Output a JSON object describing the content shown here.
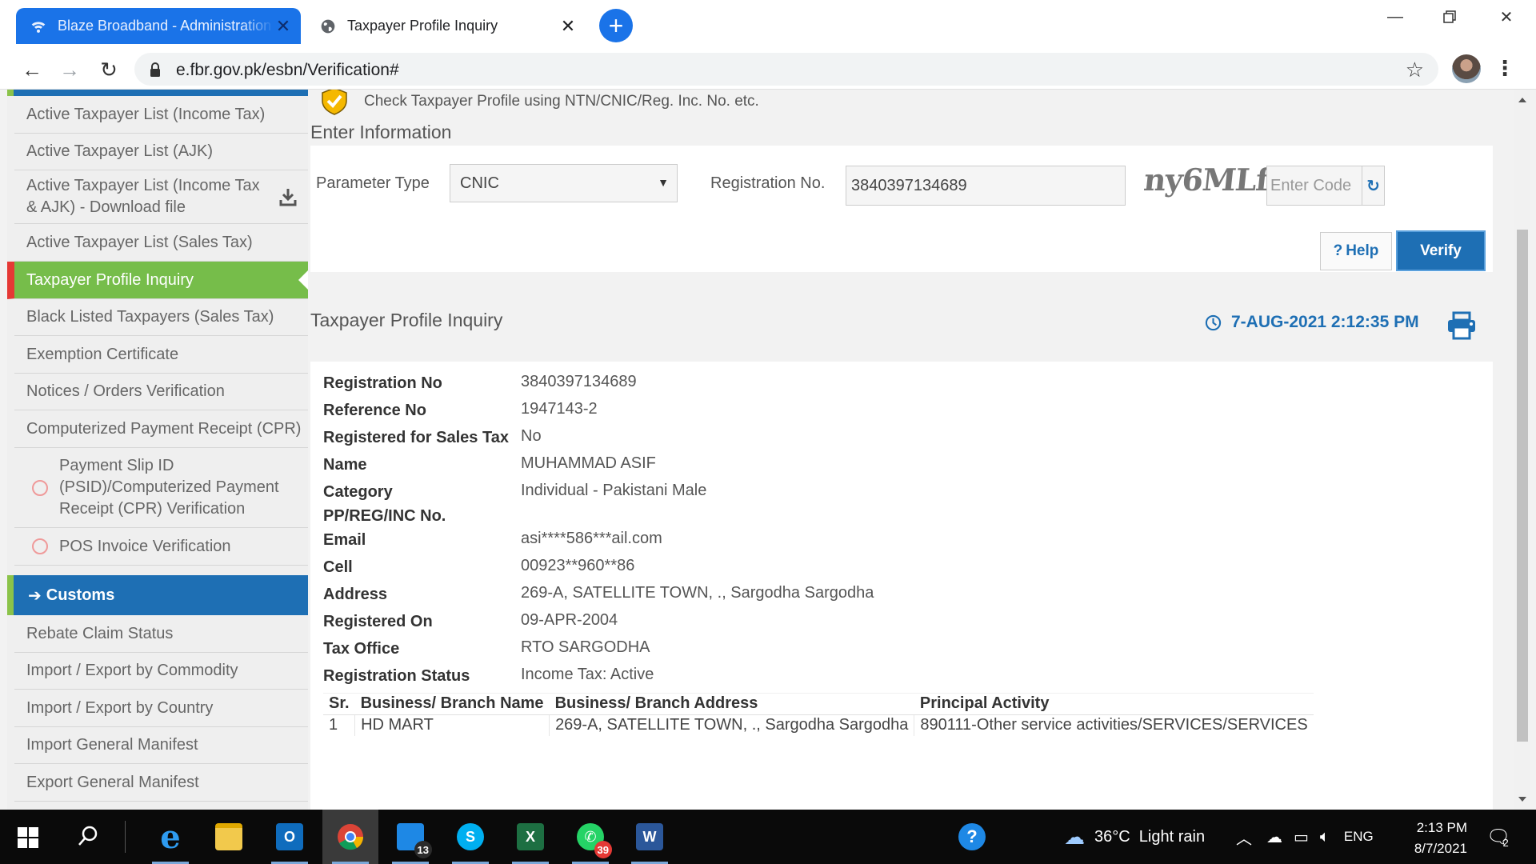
{
  "browser": {
    "tabs": [
      {
        "title": "Blaze Broadband - Administration",
        "active": false
      },
      {
        "title": "Taxpayer Profile Inquiry",
        "active": true
      }
    ],
    "url": "e.fbr.gov.pk/esbn/Verification#"
  },
  "sidebar": {
    "items": [
      {
        "label": "Active Taxpayer List (Income Tax)"
      },
      {
        "label": "Active Taxpayer List (AJK)"
      },
      {
        "label": "Active Taxpayer List (Income Tax & AJK) - Download file"
      },
      {
        "label": "Active Taxpayer List (Sales Tax)"
      },
      {
        "label": "Taxpayer Profile Inquiry"
      },
      {
        "label": "Black Listed Taxpayers (Sales Tax)"
      },
      {
        "label": "Exemption Certificate"
      },
      {
        "label": "Notices / Orders Verification"
      },
      {
        "label": "Computerized Payment Receipt (CPR)"
      },
      {
        "label": "Payment Slip ID (PSID)/Computerized Payment Receipt (CPR) Verification"
      },
      {
        "label": "POS Invoice Verification"
      }
    ],
    "customs_header": "Customs",
    "customs_items": [
      {
        "label": "Rebate Claim Status"
      },
      {
        "label": "Import / Export by Commodity"
      },
      {
        "label": "Import / Export by Country"
      },
      {
        "label": "Import General Manifest"
      },
      {
        "label": "Export General Manifest"
      }
    ]
  },
  "form": {
    "check_text": "Check Taxpayer Profile using NTN/CNIC/Reg. Inc. No. etc.",
    "enter_info": "Enter Information",
    "param_label": "Parameter Type",
    "param_value": "CNIC",
    "reg_label": "Registration No.",
    "reg_value": "3840397134689",
    "captcha_text": "ny6MLf",
    "code_placeholder": "Enter Code",
    "help_label": "Help",
    "verify_label": "Verify"
  },
  "result": {
    "title": "Taxpayer Profile Inquiry",
    "timestamp": "7-AUG-2021 2:12:35 PM",
    "fields": [
      {
        "key": "Registration No",
        "value": "3840397134689"
      },
      {
        "key": "Reference No",
        "value": "1947143-2"
      },
      {
        "key": "Registered for Sales Tax",
        "value": "No"
      },
      {
        "key": "Name",
        "value": "MUHAMMAD ASIF"
      },
      {
        "key": "Category",
        "value": "Individual - Pakistani Male"
      },
      {
        "key": "PP/REG/INC No.",
        "value": ""
      },
      {
        "key": "Email",
        "value": "asi****586***ail.com"
      },
      {
        "key": "Cell",
        "value": "00923**960**86"
      },
      {
        "key": "Address",
        "value": "269-A, SATELLITE TOWN, ., Sargodha Sargodha"
      },
      {
        "key": "Registered On",
        "value": "09-APR-2004"
      },
      {
        "key": "Tax Office",
        "value": "RTO SARGODHA"
      },
      {
        "key": "Registration Status",
        "value": "Income Tax: Active"
      }
    ],
    "table": {
      "headers": [
        "Sr.",
        "Business/ Branch Name",
        "Business/ Branch Address",
        "Principal Activity"
      ],
      "rows": [
        [
          "1",
          "HD MART",
          "269-A, SATELLITE TOWN, ., Sargodha Sargodha",
          "890111-Other service activities/SERVICES/SERVICES"
        ]
      ]
    }
  },
  "taskbar": {
    "badges": {
      "files": "13",
      "whatsapp": "39"
    },
    "weather": "36°C  Light rain",
    "language": "ENG",
    "time": "2:13 PM",
    "date": "8/7/2021",
    "notifications": "2"
  },
  "colors": {
    "accent_blue": "#1e6fb4",
    "active_green": "#76bd4a",
    "active_marker_red": "#e53935",
    "tab_blue": "#1a73e8"
  }
}
